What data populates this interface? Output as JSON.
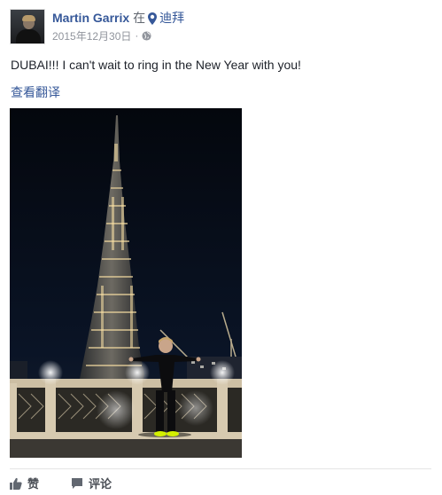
{
  "post": {
    "author": "Martin Garrix",
    "at_word": "在",
    "location": "迪拜",
    "date": "2015年12月30日",
    "separator": "·",
    "text": "DUBAI!!! I can't wait to ring in the New Year with you!",
    "translate_label": "查看翻译"
  },
  "icons": {
    "location": "location-pin-icon",
    "privacy": "globe-icon",
    "like": "thumbs-up-icon",
    "comment": "comment-bubble-icon"
  },
  "actions": {
    "like_label": "赞",
    "comment_label": "评论"
  },
  "colors": {
    "link": "#365899",
    "text": "#1d2129",
    "muted": "#90949c",
    "action": "#4b4f56"
  }
}
